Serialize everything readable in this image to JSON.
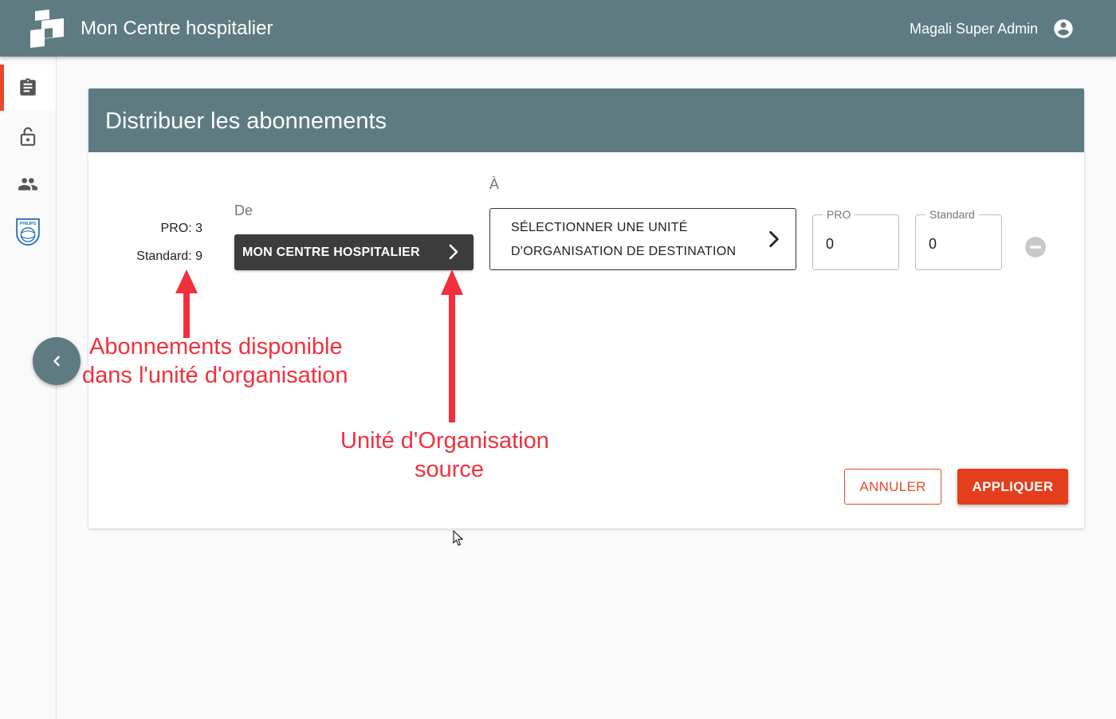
{
  "header": {
    "app_title": "Mon Centre hospitalier",
    "user_name": "Magali Super Admin",
    "logo_icon": "app-logo-icon",
    "account_icon": "account-circle-icon"
  },
  "sidebar": {
    "items": [
      {
        "icon": "clipboard-icon",
        "active": true
      },
      {
        "icon": "lock-open-icon",
        "active": false
      },
      {
        "icon": "people-icon",
        "active": false
      },
      {
        "icon": "philips-shield-icon",
        "active": false,
        "logo_text": "PHILIPS"
      }
    ],
    "collapse_icon": "chevron-left-icon"
  },
  "card": {
    "title": "Distribuer les abonnements",
    "available": {
      "pro": "PRO: 3",
      "standard": "Standard: 9"
    },
    "from_label": "De",
    "source_unit": "MON CENTRE HOSPITALIER",
    "to_label": "À",
    "destination": {
      "line1": "SÉLECTIONNER UNE UNITÉ",
      "line2": "D'ORGANISATION DE DESTINATION"
    },
    "pro_field": {
      "label": "PRO",
      "value": "0"
    },
    "standard_field": {
      "label": "Standard",
      "value": "0"
    },
    "remove_icon": "remove-circle-icon",
    "cancel_label": "ANNULER",
    "apply_label": "APPLIQUER"
  },
  "annotations": {
    "available_note_line1": "Abonnements disponible",
    "available_note_line2": "dans l'unité d'organisation",
    "source_note_line1": "Unité d'Organisation",
    "source_note_line2": "source"
  },
  "colors": {
    "header": "#5f7b82",
    "accent": "#e8492a",
    "annotation": "#f2303d",
    "source_button": "#3c3c3c"
  }
}
